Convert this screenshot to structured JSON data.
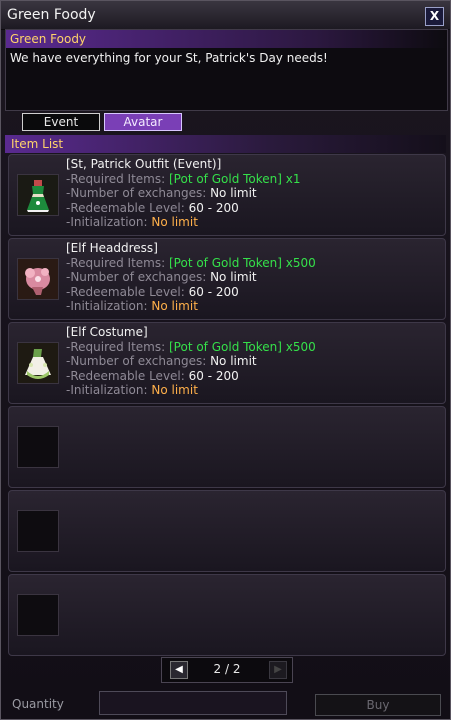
{
  "window": {
    "title": "Green Foody",
    "close_label": "X"
  },
  "npc": {
    "name": "Green Foody",
    "dialog": "We have everything for your St, Patrick's Day needs!"
  },
  "tabs": [
    {
      "label": "Event",
      "selected": false
    },
    {
      "label": "Avatar",
      "selected": true
    }
  ],
  "item_list": {
    "header": "Item List",
    "field_labels": {
      "required": "-Required Items: ",
      "exchanges": "-Number of exchanges: ",
      "level": "-Redeemable Level: ",
      "init": "-Initialization: "
    },
    "items": [
      {
        "name": "[St, Patrick Outfit (Event)]",
        "icon": "green-dress-icon",
        "required": "[Pot of Gold Token] x1",
        "exchanges": "No limit",
        "level": "60 - 200",
        "init": "No limit"
      },
      {
        "name": "[Elf Headdress]",
        "icon": "pink-headdress-icon",
        "required": "[Pot of Gold Token] x500",
        "exchanges": "No limit",
        "level": "60 - 200",
        "init": "No limit"
      },
      {
        "name": "[Elf Costume]",
        "icon": "white-green-dress-icon",
        "required": "[Pot of Gold Token] x500",
        "exchanges": "No limit",
        "level": "60 - 200",
        "init": "No limit"
      }
    ],
    "empty_slot_count": 3
  },
  "pagination": {
    "text": "2 / 2",
    "prev_icon": "triangle-left-icon",
    "next_icon": "triangle-right-icon"
  },
  "footer": {
    "quantity_label": "Quantity",
    "buy_label": "Buy"
  },
  "colors": {
    "accent_purple": "#7a3fb6",
    "header_gold": "#ffd36a",
    "required_green": "#35e04a",
    "init_orange": "#ffb04a"
  }
}
